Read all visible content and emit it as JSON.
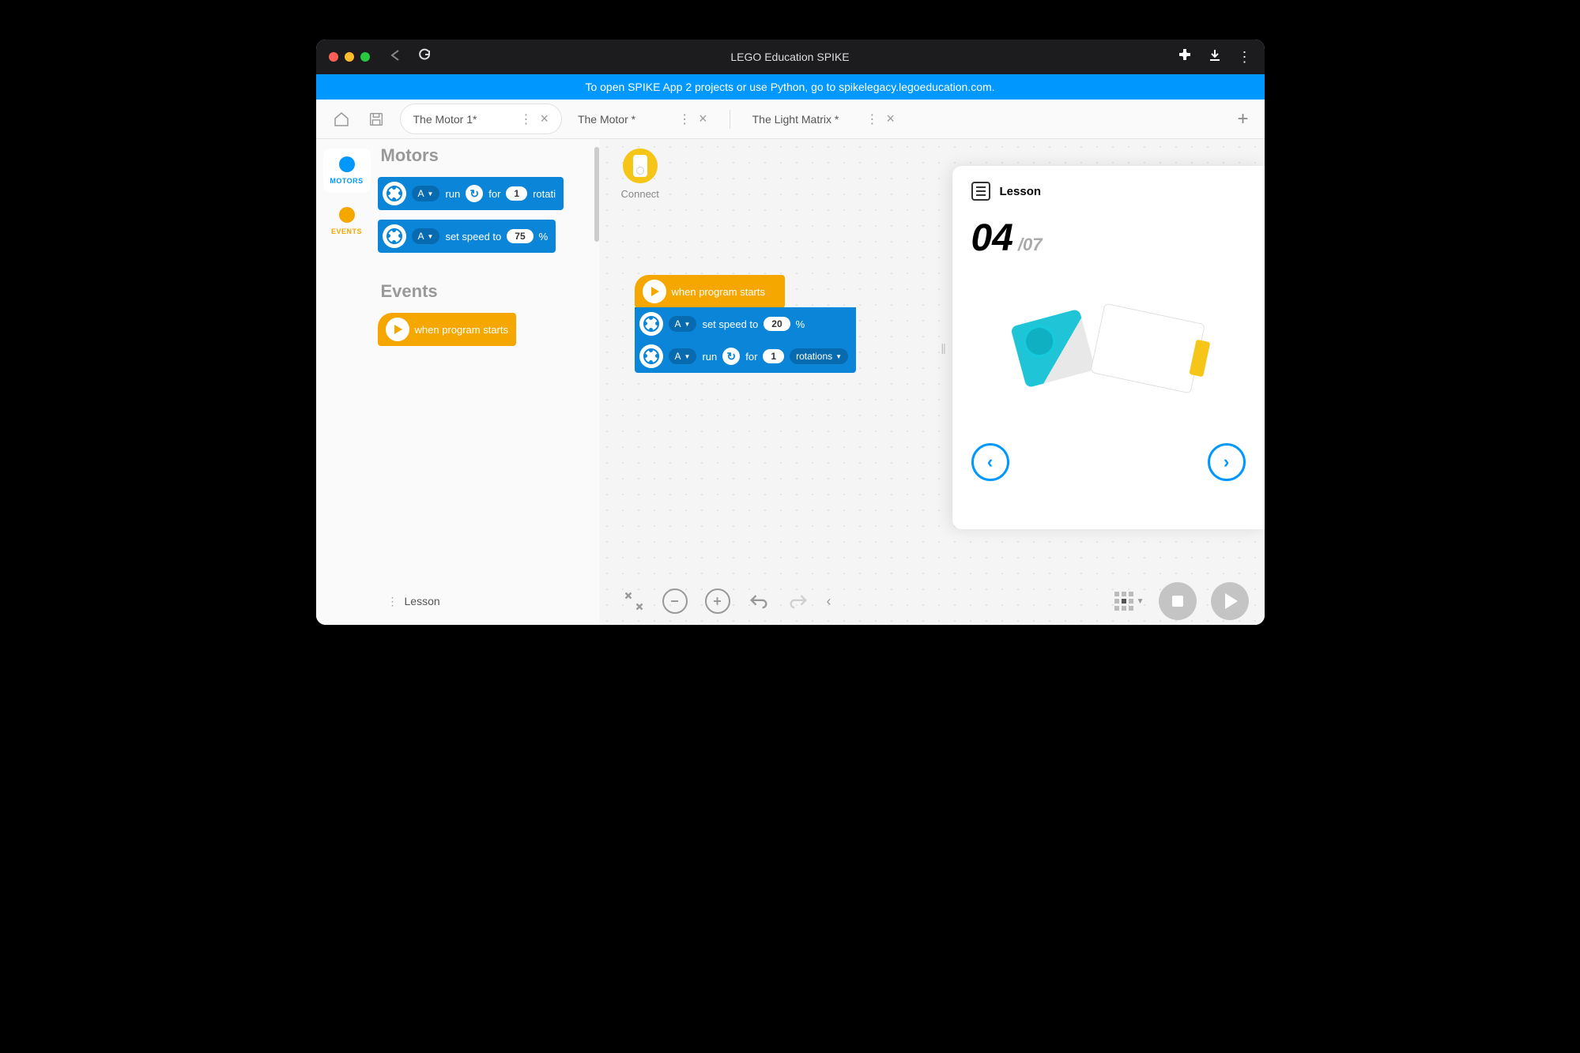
{
  "titlebar": {
    "title": "LEGO Education SPIKE"
  },
  "banner": {
    "text": "To open SPIKE App 2 projects or use Python, go to spikelegacy.legoeducation.com."
  },
  "tabs": [
    {
      "label": "The Motor 1*",
      "active": true
    },
    {
      "label": "The Motor *",
      "active": false
    },
    {
      "label": "The Light Matrix *",
      "active": false
    }
  ],
  "categories": [
    {
      "label": "MOTORS",
      "color": "#0098ff",
      "active": true
    },
    {
      "label": "EVENTS",
      "color": "#f5a700",
      "active": false
    }
  ],
  "palette": {
    "motors_heading": "Motors",
    "events_heading": "Events",
    "block_run": {
      "port": "A",
      "text_run": "run",
      "text_for": "for",
      "value": "1",
      "unit": "rotati"
    },
    "block_speed": {
      "port": "A",
      "text": "set speed to",
      "value": "75",
      "unit": "%"
    },
    "block_start": {
      "text": "when program starts"
    }
  },
  "canvas": {
    "connect": "Connect",
    "program": {
      "start": {
        "text": "when program starts"
      },
      "speed": {
        "port": "A",
        "text": "set speed to",
        "value": "20",
        "unit": "%"
      },
      "run": {
        "port": "A",
        "text_run": "run",
        "text_for": "for",
        "value": "1",
        "unit": "rotations"
      }
    }
  },
  "lesson": {
    "title": "Lesson",
    "current": "04",
    "total": "/07"
  },
  "footer": {
    "lesson": "Lesson"
  }
}
